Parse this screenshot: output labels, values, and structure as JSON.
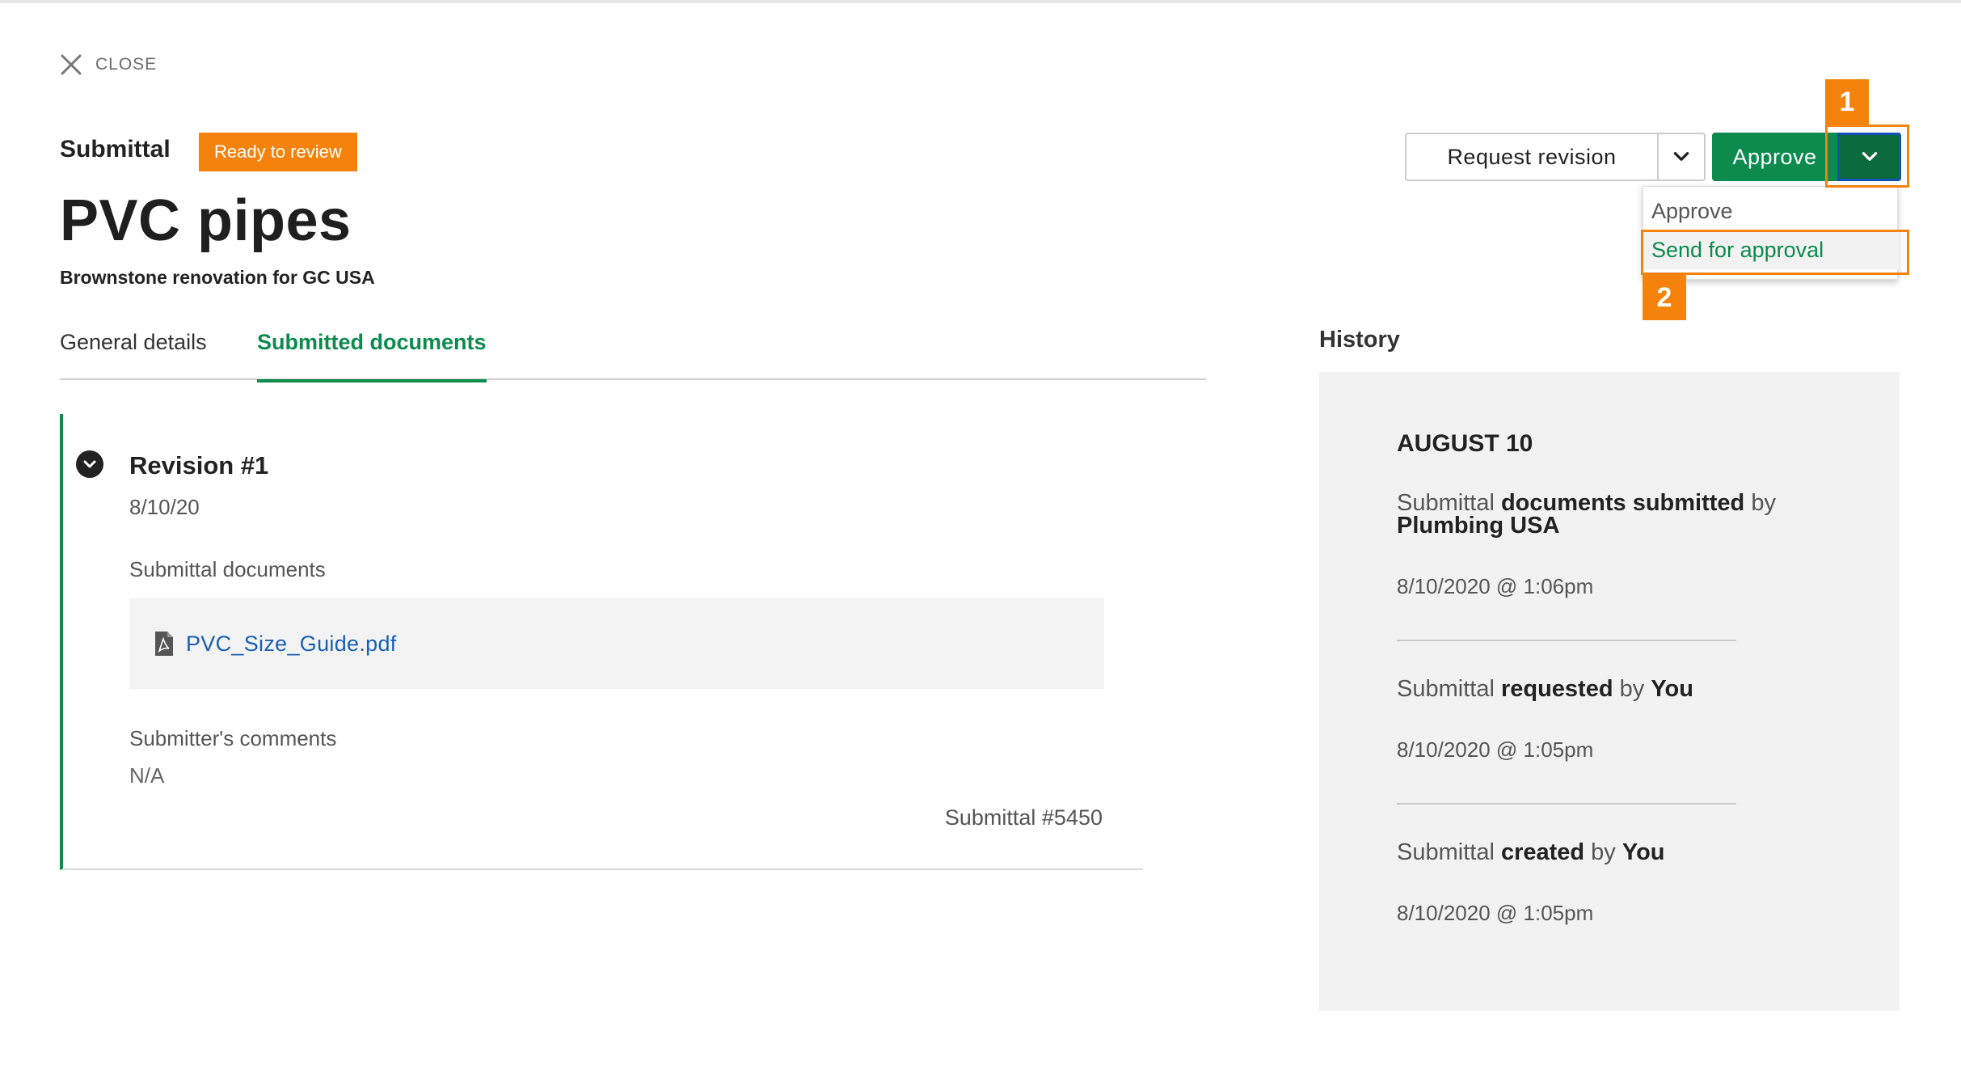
{
  "close": {
    "label": "CLOSE"
  },
  "header": {
    "type_label": "Submittal",
    "status": "Ready to review",
    "title": "PVC pipes",
    "project": "Brownstone renovation for GC USA"
  },
  "tabs": [
    {
      "label": "General details",
      "active": false
    },
    {
      "label": "Submitted documents",
      "active": true
    }
  ],
  "revision": {
    "title": "Revision #1",
    "date": "8/10/20",
    "documents_label": "Submittal documents",
    "document_name": "PVC_Size_Guide.pdf",
    "comments_label": "Submitter's comments",
    "comments_value": "N/A",
    "submittal_number": "Submittal #5450"
  },
  "actions": {
    "request_revision": "Request revision",
    "approve": "Approve",
    "menu": [
      "Approve",
      "Send for approval"
    ]
  },
  "callouts": [
    "1",
    "2"
  ],
  "history": {
    "title": "History",
    "date": "AUGUST 10",
    "entries": [
      {
        "p1": "Submittal ",
        "b1": "documents submitted",
        "p2": " by ",
        "b2": "Plumbing USA",
        "time": "8/10/2020 @ 1:06pm"
      },
      {
        "p1": "Submittal ",
        "b1": "requested",
        "p2": " by ",
        "b2": "You",
        "time": "8/10/2020 @ 1:05pm"
      },
      {
        "p1": "Submittal ",
        "b1": "created",
        "p2": " by ",
        "b2": "You",
        "time": "8/10/2020 @ 1:05pm"
      }
    ]
  },
  "colors": {
    "brand_green": "#0d8a4e",
    "status_orange": "#f5830b",
    "link_blue": "#1a5fb4"
  }
}
